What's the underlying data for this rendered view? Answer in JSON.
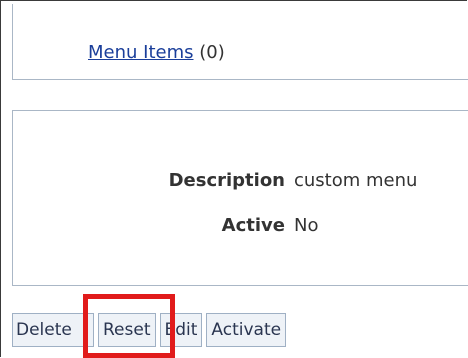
{
  "menu_items": {
    "link_label": "Menu Items",
    "count": "(0)"
  },
  "details": {
    "description_label": "Description",
    "description_value": "custom menu",
    "active_label": "Active",
    "active_value": "No"
  },
  "buttons": {
    "delete": "Delete",
    "reset": "Reset",
    "edit": "Edit",
    "activate": "Activate"
  },
  "colors": {
    "highlight": "#e11b1b",
    "link": "#1a3e9a",
    "panel_border": "#aab7c6"
  }
}
